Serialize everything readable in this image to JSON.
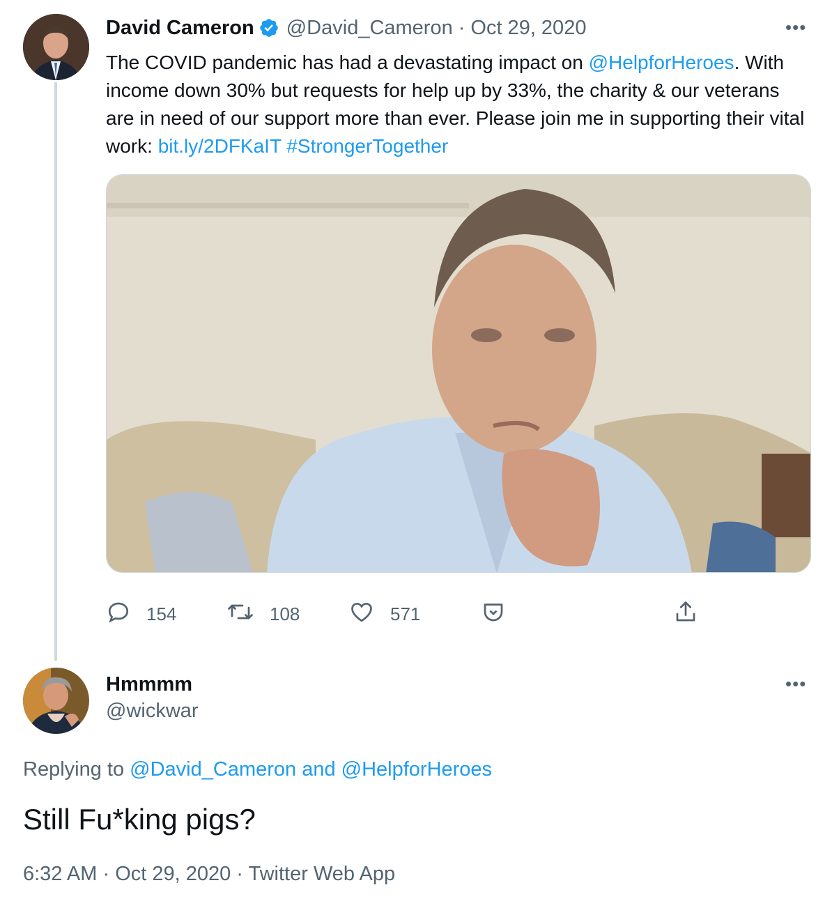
{
  "tweet": {
    "author_name": "David Cameron",
    "handle": "@David_Cameron",
    "separator": "·",
    "date": "Oct 29, 2020",
    "more_label": "•••",
    "text_parts": {
      "p1": "The COVID pandemic has had a devastating impact on ",
      "mention": "@HelpforHeroes",
      "p2": ". With income down 30% but requests for help up by 33%, the charity & our veterans are in need of our support more than ever. Please join me in supporting their vital work: ",
      "url": "bit.ly/2DFKaIT",
      "space": " ",
      "hashtag": "#StrongerTogether"
    },
    "actions": {
      "reply_count": "154",
      "retweet_count": "108",
      "like_count": "571"
    }
  },
  "reply": {
    "author_name": "Hmmmm",
    "handle": "@wickwar",
    "more_label": "•••",
    "replying_prefix": "Replying to ",
    "replying_user1": "@David_Cameron",
    "replying_and": " and ",
    "replying_user2": "@HelpforHeroes",
    "text": "Still Fu*king pigs?",
    "time": "6:32 AM",
    "separator1": " · ",
    "date": "Oct 29, 2020",
    "separator2": " · ",
    "source": "Twitter Web App"
  },
  "colors": {
    "link": "#1d9bf0",
    "muted": "#536471",
    "text": "#0f1419",
    "thread_line": "#cfd9de"
  },
  "icons": [
    "verified-badge-icon",
    "reply-icon",
    "retweet-icon",
    "like-icon",
    "tip-jar-icon",
    "share-icon"
  ]
}
